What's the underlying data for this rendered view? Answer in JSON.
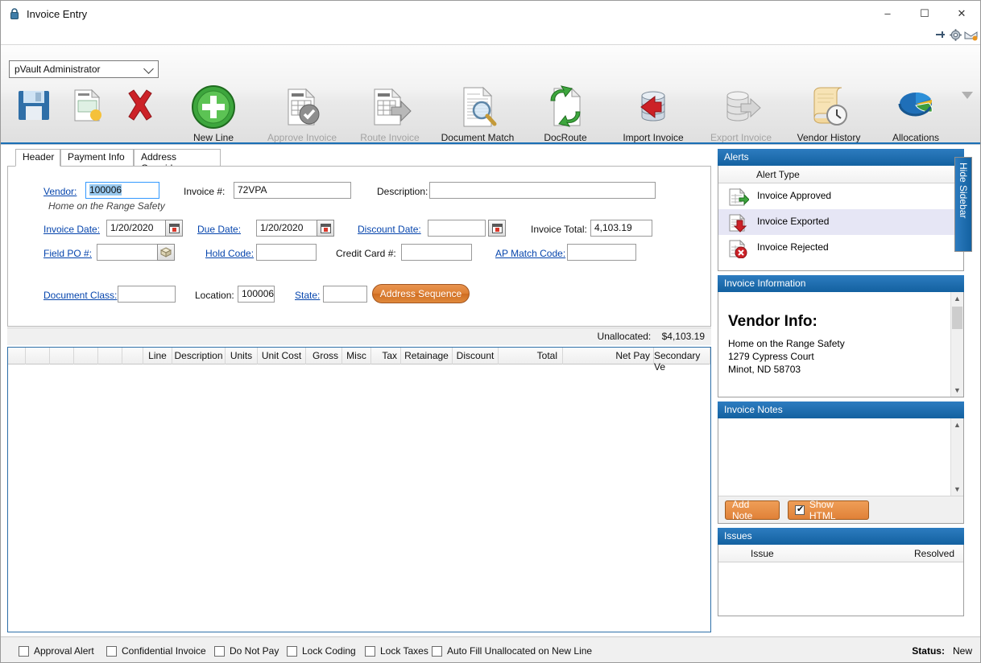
{
  "window": {
    "title": "Invoice Entry",
    "lock_icon": "lock-icon",
    "minimize": "–",
    "maximize": "☐",
    "close": "✕"
  },
  "quick_icons": [
    {
      "name": "pin-icon",
      "glyph": "⮚"
    },
    {
      "name": "gear-icon",
      "glyph": "⚙"
    },
    {
      "name": "mail-icon",
      "glyph": "✉"
    }
  ],
  "toolbar": {
    "user_select": "pVault Administrator",
    "small_buttons": [
      {
        "name": "save-button",
        "icon": "floppy-disk-icon"
      },
      {
        "name": "new-invoice-button",
        "icon": "invoice-new-icon"
      },
      {
        "name": "delete-button",
        "icon": "red-x-icon"
      }
    ],
    "buttons": [
      {
        "label": "New Line",
        "key": "",
        "icon": "green-plus-icon",
        "disabled": false,
        "caret": true
      },
      {
        "label": "Approve Invoice",
        "key": "Ctrl + A",
        "icon": "invoice-check-icon",
        "disabled": true,
        "caret": false
      },
      {
        "label": "Route Invoice",
        "key": "Ctrl + R",
        "icon": "invoice-arrow-icon",
        "disabled": true,
        "caret": false
      },
      {
        "label": "Document Match",
        "key": "Ctrl + M",
        "icon": "document-magnify-icon",
        "disabled": false,
        "caret": false
      },
      {
        "label": "DocRoute",
        "key": "Ctrl + D",
        "icon": "doc-recycle-icon",
        "disabled": false,
        "caret": false
      },
      {
        "label": "Import Invoice",
        "key": "Ctrl + I",
        "icon": "db-import-icon",
        "disabled": false,
        "caret": false
      },
      {
        "label": "Export Invoice",
        "key": "Ctrl + E",
        "icon": "db-export-icon",
        "disabled": true,
        "caret": false
      },
      {
        "label": "Vendor History",
        "key": "Ctrl + H",
        "icon": "scroll-clock-icon",
        "disabled": false,
        "caret": false
      },
      {
        "label": "Allocations",
        "key": "",
        "icon": "pie-chart-icon",
        "disabled": false,
        "caret": true
      }
    ],
    "overflow_icon": "chevron-down-icon"
  },
  "tabs": [
    {
      "label": "Header",
      "active": true
    },
    {
      "label": "Payment Info",
      "active": false
    },
    {
      "label": "Address Override",
      "active": false
    }
  ],
  "header_form": {
    "vendor_label": "Vendor:",
    "vendor_value": "100006",
    "vendor_name": "Home on the Range Safety",
    "invoice_num_label": "Invoice #:",
    "invoice_num_value": "72VPA",
    "description_label": "Description:",
    "description_value": "",
    "invoice_date_label": "Invoice Date:",
    "invoice_date_value": "1/20/2020",
    "due_date_label": "Due Date:",
    "due_date_value": "1/20/2020",
    "discount_date_label": "Discount Date:",
    "discount_date_value": "",
    "invoice_total_label": "Invoice Total:",
    "invoice_total_value": "4,103.19",
    "field_po_label": "Field PO #:",
    "field_po_value": "",
    "hold_code_label": "Hold Code:",
    "hold_code_value": "",
    "credit_card_label": "Credit Card #:",
    "credit_card_value": "",
    "ap_match_label": "AP Match Code:",
    "ap_match_value": "",
    "document_class_label": "Document Class:",
    "document_class_value": "",
    "location_label": "Location:",
    "location_value": "100006",
    "state_label": "State:",
    "state_value": "",
    "address_sequence_button": "Address Sequence"
  },
  "unallocated": {
    "label": "Unallocated:",
    "value": "$4,103.19"
  },
  "grid": {
    "columns": [
      "Line",
      "Description",
      "Units",
      "Unit Cost",
      "Gross",
      "Misc",
      "Tax",
      "Retainage",
      "Discount",
      "Total",
      "Net Pay",
      "Secondary Ve"
    ],
    "rows": []
  },
  "sidebar": {
    "hide_label": "Hide Sidebar",
    "alerts": {
      "title": "Alerts",
      "column": "Alert Type",
      "rows": [
        {
          "label": "Invoice Approved",
          "icon": "invoice-green-arrow-icon",
          "selected": false
        },
        {
          "label": "Invoice Exported",
          "icon": "invoice-red-down-arrow-icon",
          "selected": true
        },
        {
          "label": "Invoice Rejected",
          "icon": "invoice-red-x-icon",
          "selected": false
        }
      ]
    },
    "invoice_information": {
      "title": "Invoice Information",
      "heading": "Vendor Info:",
      "lines": [
        "Home on the Range Safety",
        "1279 Cypress Court",
        "Minot, ND 58703"
      ]
    },
    "invoice_notes": {
      "title": "Invoice Notes",
      "content": "",
      "add_note_button": "Add Note",
      "show_html_label": "Show HTML",
      "show_html_checked": true
    },
    "issues": {
      "title": "Issues",
      "columns": [
        "Issue",
        "Resolved"
      ],
      "rows": []
    }
  },
  "statusbar": {
    "checkboxes": [
      {
        "label": "Approval Alert",
        "checked": false
      },
      {
        "label": "Confidential Invoice",
        "checked": false
      },
      {
        "label": "Do Not Pay",
        "checked": false
      },
      {
        "label": "Lock Coding",
        "checked": false
      },
      {
        "label": "Lock Taxes",
        "checked": false
      },
      {
        "label": "Auto Fill Unallocated on New Line",
        "checked": false
      }
    ],
    "status_label": "Status:",
    "status_value": "New"
  },
  "colors": {
    "accent_blue": "#1361a0",
    "orange": "#e08138",
    "link": "#0645ad"
  }
}
